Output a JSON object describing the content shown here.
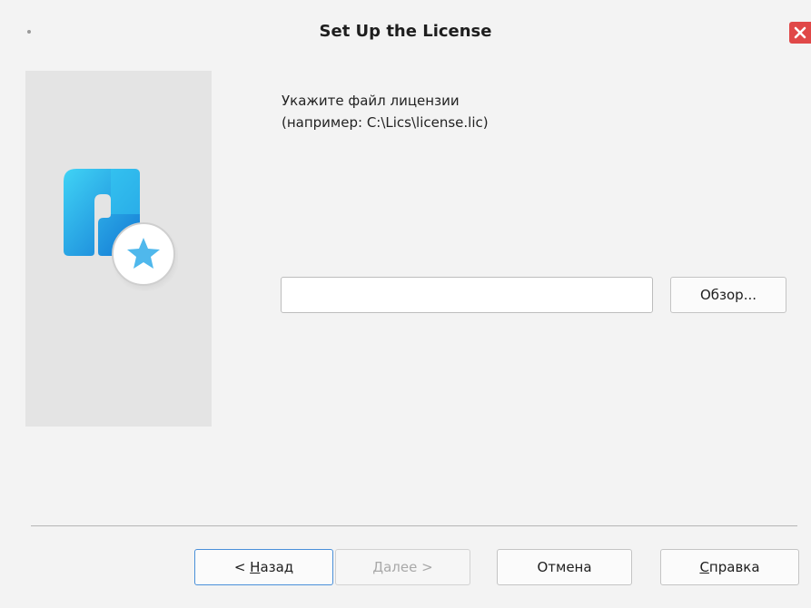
{
  "window": {
    "title": "Set Up the License"
  },
  "content": {
    "instruction_line1": "Укажите файл лицензии",
    "instruction_line2": "(например: C:\\Lics\\license.lic)",
    "license_path_value": "",
    "browse_label": "Обзор..."
  },
  "footer": {
    "back": {
      "mnemonic": "Н",
      "rest": "азад",
      "prefix": "< "
    },
    "next": {
      "mnemonic": "Д",
      "rest": "алее >",
      "enabled": false
    },
    "cancel_label": "Отмена",
    "help": {
      "mnemonic": "С",
      "rest": "правка"
    }
  },
  "icons": {
    "close": "close-icon",
    "logo": "app-logo-icon",
    "star": "star-icon"
  },
  "colors": {
    "close_button": "#e04848",
    "logo_blue": "#1f8fe0",
    "logo_cyan": "#37c8f0",
    "star": "#4fb8ec",
    "focus_border": "#4a90d9"
  }
}
